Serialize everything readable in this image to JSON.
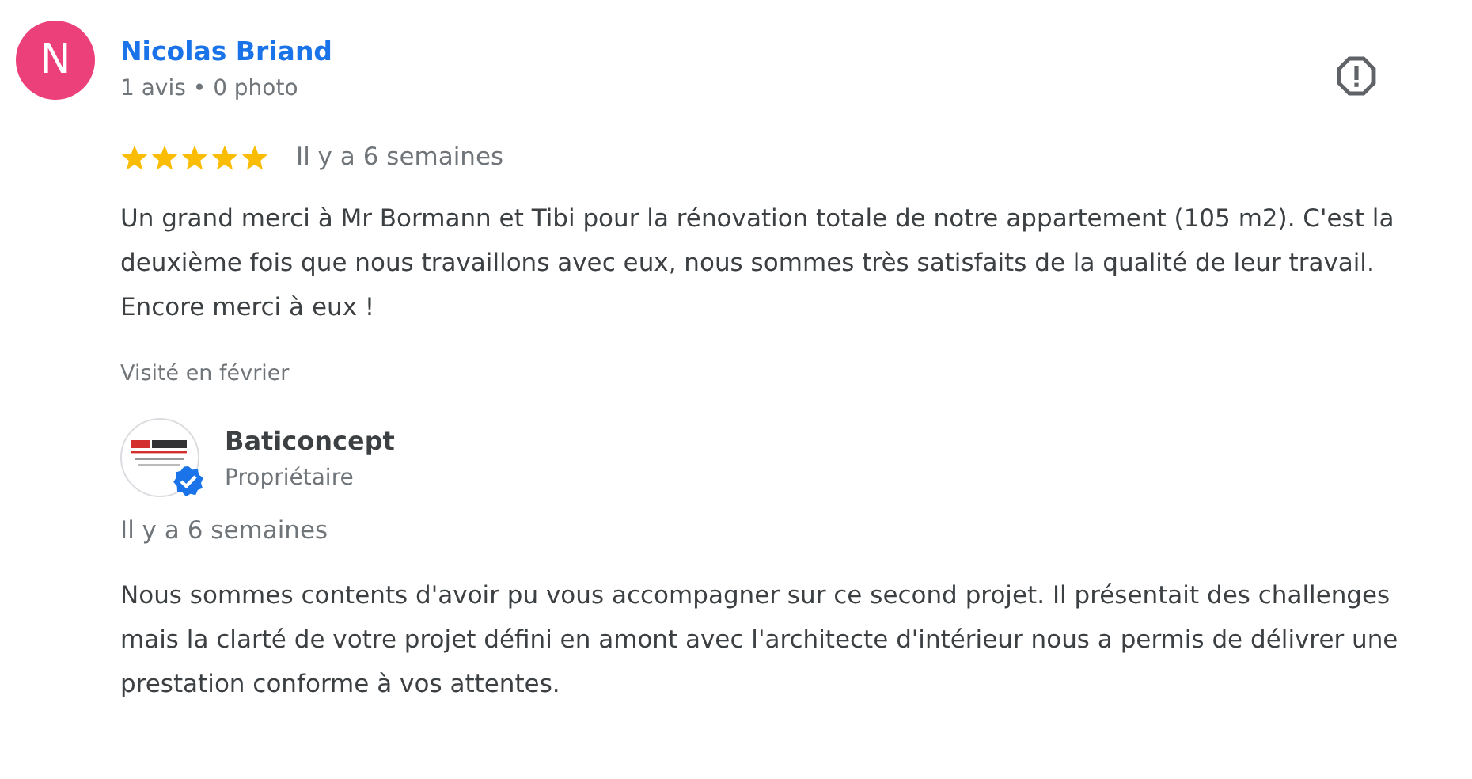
{
  "reviewer": {
    "initial": "N",
    "name": "Nicolas Briand",
    "meta": "1 avis • 0 photo"
  },
  "review": {
    "stars": 5,
    "date": "Il y a 6 semaines",
    "text": "Un grand merci à Mr Bormann et Tibi pour la rénovation totale de notre appartement (105 m2). C'est la deuxième fois que nous travaillons avec eux, nous sommes très satisfaits de la qualité de leur travail. Encore merci à eux !",
    "visited": "Visité en février"
  },
  "reply": {
    "name": "Baticoncept",
    "role": "Propriétaire",
    "verified": true,
    "date": "Il y a 6 semaines",
    "text": "Nous sommes contents d'avoir pu vous accompagner sur ce second projet. Il présentait des challenges mais la clarté de votre projet défini en amont avec l'architecte d'intérieur nous a permis de délivrer une prestation conforme à vos attentes."
  }
}
